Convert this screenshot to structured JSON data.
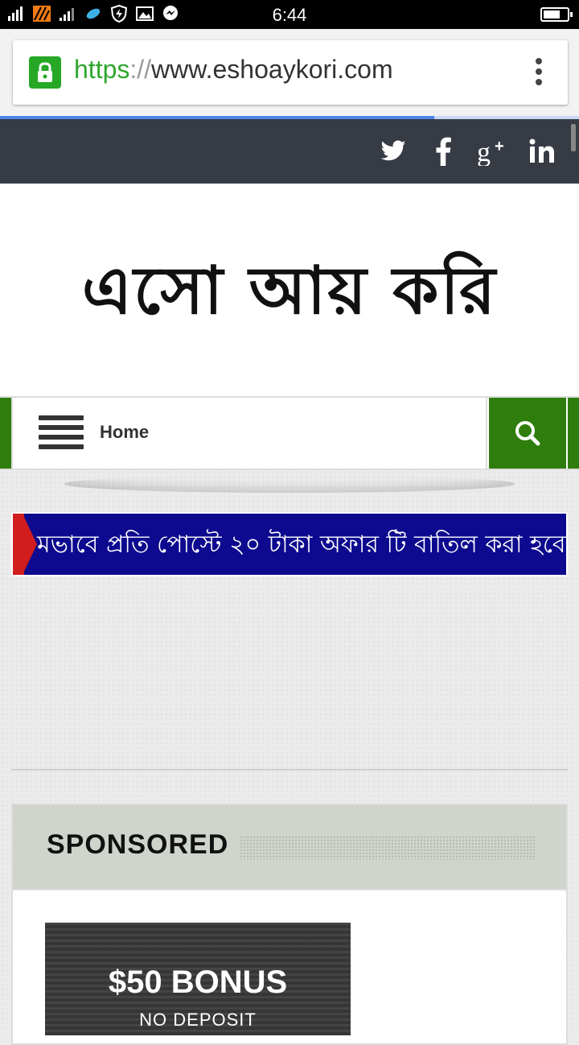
{
  "status_bar": {
    "time": "6:44",
    "icons": [
      "signal-icon",
      "tiger-icon",
      "signal-bars-icon",
      "telenor-icon",
      "shield-icon",
      "gallery-icon",
      "messenger-icon"
    ],
    "battery_level": 0.65
  },
  "browser": {
    "url_scheme": "https",
    "url_separator": "://",
    "url_host": "www.eshoaykori.com",
    "page_load_progress": 0.75
  },
  "social": [
    "twitter-icon",
    "facebook-icon",
    "google-plus-icon",
    "linkedin-icon"
  ],
  "logo": {
    "text": "এসো আয় করি"
  },
  "nav": {
    "home_label": "Home"
  },
  "ticker": {
    "text": "মভাবে প্রতি পোস্টে ২০ টাকা অফার টি বাতিল করা হবে"
  },
  "sponsored": {
    "title": "SPONSORED",
    "ad_headline": "$50 BONUS",
    "ad_subline": "NO DEPOSIT"
  },
  "colors": {
    "nav_green": "#2f7d0c",
    "ticker_blue": "#0d0a8f",
    "social_bar": "#363b44",
    "url_green": "#2fa72f"
  }
}
